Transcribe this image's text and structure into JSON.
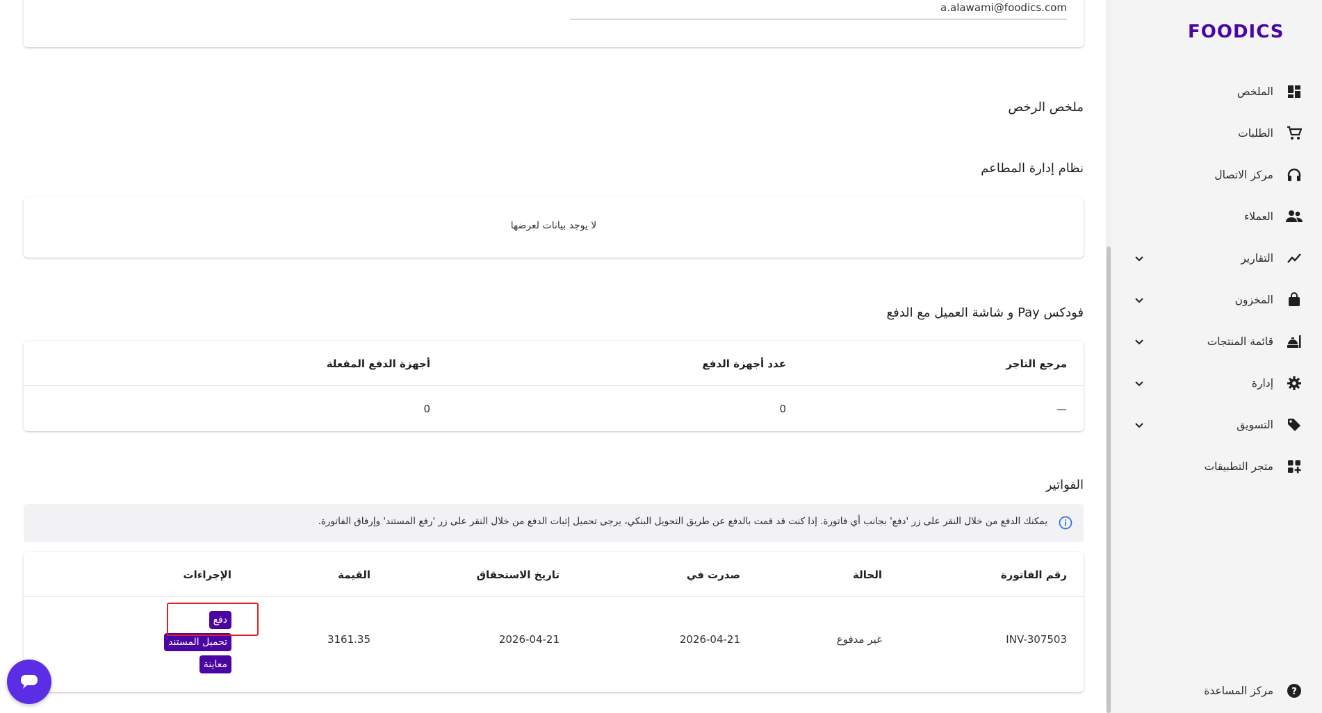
{
  "brand": {
    "logo_text": "FOODICS",
    "accent": "#4a05a3"
  },
  "sidebar": {
    "items": [
      {
        "label": "الملخص",
        "icon": "dashboard-icon",
        "expandable": false
      },
      {
        "label": "الطلبات",
        "icon": "cart-icon",
        "expandable": false
      },
      {
        "label": "مركز الاتصال",
        "icon": "headset-icon",
        "expandable": false
      },
      {
        "label": "العملاء",
        "icon": "people-icon",
        "expandable": false
      },
      {
        "label": "التقارير",
        "icon": "chart-line-icon",
        "expandable": true
      },
      {
        "label": "المخزون",
        "icon": "bag-icon",
        "expandable": true
      },
      {
        "label": "قائمة المنتجات",
        "icon": "menu-food-icon",
        "expandable": true
      },
      {
        "label": "إدارة",
        "icon": "gear-icon",
        "expandable": true
      },
      {
        "label": "التسويق",
        "icon": "tag-icon",
        "expandable": true
      },
      {
        "label": "متجر التطبيقات",
        "icon": "apps-icon",
        "expandable": false
      }
    ],
    "help": {
      "label": "مركز المساعدة",
      "icon": "help-icon"
    }
  },
  "account": {
    "email": "a.alawami@foodics.com"
  },
  "licenses": {
    "title": "ملخص الرخص"
  },
  "restaurant_system": {
    "title": "نظام إدارة المطاعم",
    "empty_text": "لا يوجد بيانات لعرضها"
  },
  "pay": {
    "title": "فودكس Pay و شاشة العميل مع الدفع",
    "columns": [
      "مرجع التاجر",
      "عدد أجهزة الدفع",
      "أجهزة الدفع المفعلة"
    ],
    "row": [
      "—",
      "0",
      "0"
    ]
  },
  "invoices": {
    "title": "الفواتير",
    "info": "يمكنك الدفع من خلال النقر على زر 'دفع' بجانب أي فاتورة. إذا كنت قد قمت بالدفع عن طريق التحويل البنكي، يرجى تحميل إثبات الدفع من خلال النقر على زر 'رفع المستند' وإرفاق الفاتورة.",
    "columns": [
      "رقم الفاتورة",
      "الحالة",
      "صدرت في",
      "تاريخ الاستحقاق",
      "القيمة",
      "الإجراءات"
    ],
    "rows": [
      {
        "number": "INV-307503",
        "status": "غير مدفوع",
        "issued": "2026-04-21",
        "due": "2026-04-21",
        "amount": "3161.35"
      }
    ],
    "actions": {
      "pay": "دفع",
      "upload": "تحميل المستند",
      "preview": "معاينة"
    }
  }
}
